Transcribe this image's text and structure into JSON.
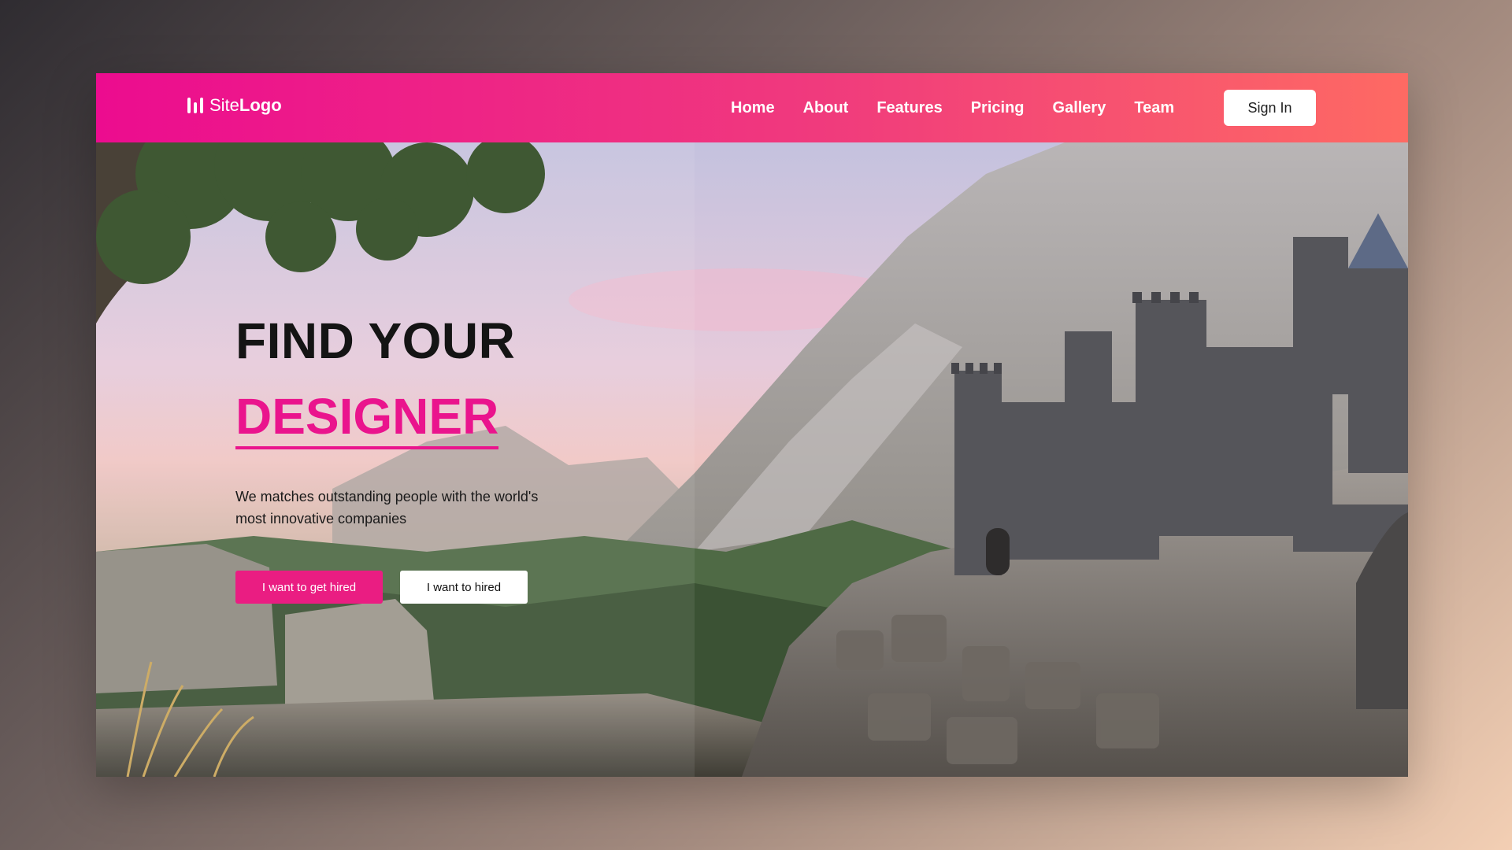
{
  "header": {
    "logo": {
      "part1": "Site",
      "part2": "Logo",
      "icon": "bars-logo-icon"
    },
    "nav": [
      "Home",
      "About",
      "Features",
      "Pricing",
      "Gallery",
      "Team"
    ],
    "signin_label": "Sign In"
  },
  "hero": {
    "title_line1": "FIND YOUR",
    "title_line2": "DESIGNER",
    "description": "We matches outstanding people with the world's most innovative companies",
    "primary_button": "I want to get hired",
    "secondary_button": "I want to hired",
    "background": "fantasy-castle-mountain-landscape"
  },
  "colors": {
    "accent": "#ea148d",
    "header_gradient_start": "#ec0c8f",
    "header_gradient_end": "#fe6a63"
  }
}
